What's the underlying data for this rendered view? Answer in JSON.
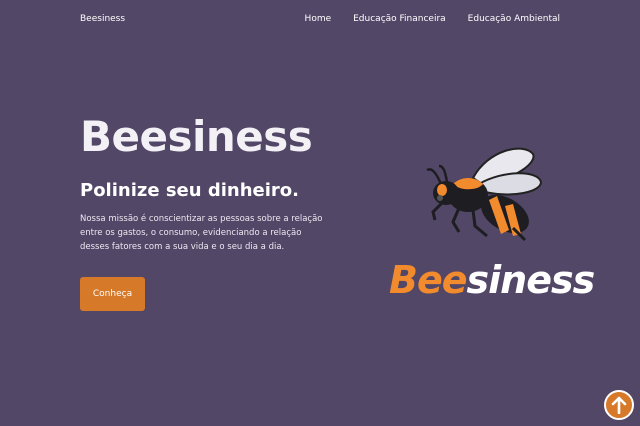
{
  "nav": {
    "brand": "Beesiness",
    "links": [
      "Home",
      "Educação Financeira",
      "Educação Ambiental"
    ]
  },
  "hero": {
    "title": "Beesiness",
    "subtitle": "Polinize seu dinheiro.",
    "description": "Nossa missão é conscientizar as pessoas sobre a relação entre os gastos, o consumo, evidenciando a relação desses fatores com a sua vida e o seu dia a dia.",
    "cta_label": "Conheça"
  },
  "logo": {
    "word_part1": "Bee",
    "word_part2": "siness",
    "icon": "bee-icon"
  },
  "scroll_top": {
    "icon": "arrow-up-icon"
  },
  "colors": {
    "background": "#524766",
    "accent": "#d67a2a",
    "logo_orange": "#f28a2e"
  }
}
